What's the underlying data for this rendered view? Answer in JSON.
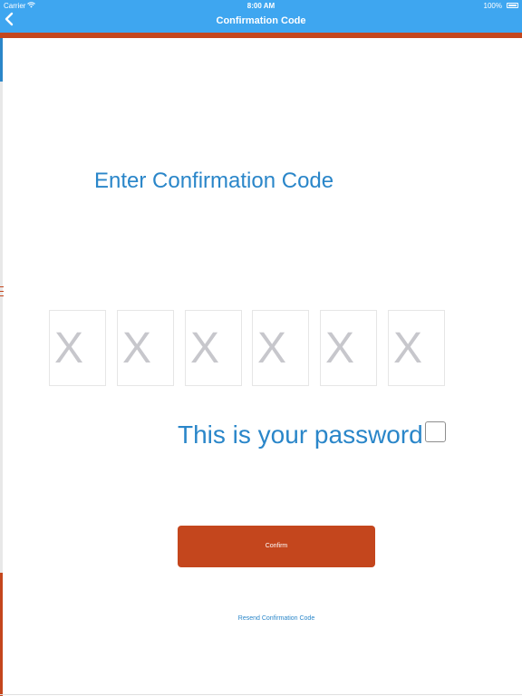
{
  "status_bar": {
    "carrier": "Carrier",
    "time": "8:00 AM",
    "battery": "100%"
  },
  "nav": {
    "title": "Confirmation Code"
  },
  "main": {
    "heading": "Enter Confirmation Code",
    "code_boxes": [
      {
        "placeholder": "X"
      },
      {
        "placeholder": "X"
      },
      {
        "placeholder": "X"
      },
      {
        "placeholder": "X"
      },
      {
        "placeholder": "X"
      },
      {
        "placeholder": "X"
      }
    ],
    "password_label": "This is your password",
    "password_checked": false,
    "confirm_label": "Confirm",
    "resend_label": "Resend Confirmation Code"
  },
  "colors": {
    "nav_background": "#3ea6f0",
    "accent": "#c4461d",
    "text_blue": "#2a86c9",
    "placeholder_gray": "#c7c7cc"
  },
  "icons": {
    "back": "chevron-left-icon",
    "wifi": "wifi-icon",
    "battery": "battery-icon"
  }
}
